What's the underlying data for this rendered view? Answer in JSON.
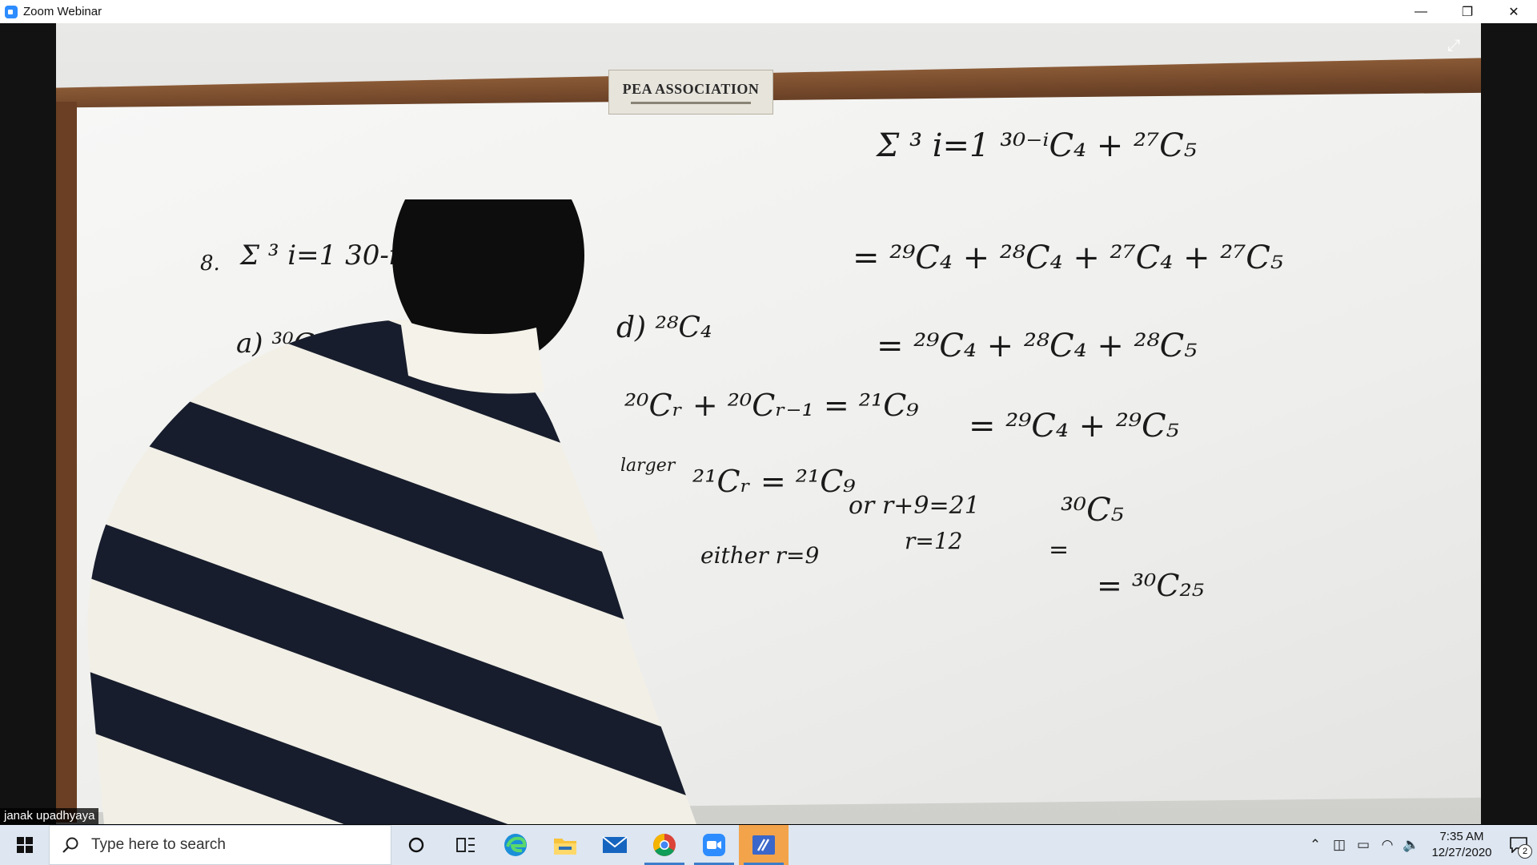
{
  "window": {
    "title": "Zoom Webinar",
    "controls": {
      "minimize": "—",
      "restore": "❐",
      "close": "✕"
    }
  },
  "video": {
    "participant_name": "janak upadhyaya",
    "plaque_title": "PEA ASSOCIATION",
    "board": {
      "left_sum_prefix": "8.",
      "left_sum": "Σ ³ i=1   30-i C₄ +",
      "option_a": "a)  ³⁰C₂₅",
      "option_d": "d)  ²⁸C₄",
      "comb_eq": "²⁰Cᵣ + ²⁰Cᵣ₋₁ = ²¹C₉",
      "larger": "larger",
      "comb_eq2": "²¹Cᵣ = ²¹C₉",
      "either": "either r=9",
      "or_line1": "or  r+9=21",
      "or_line2": "r=12",
      "rhs_sum": "Σ ³ i=1   ³⁰⁻ⁱC₄ + ²⁷C₅",
      "rhs_step1": "= ²⁹C₄ + ²⁸C₄ + ²⁷C₄ + ²⁷C₅",
      "rhs_step2": "= ²⁹C₄ + ²⁸C₄ + ²⁸C₅",
      "rhs_step3": "= ²⁹C₄ + ²⁹C₅",
      "rhs_step4": "³⁰C₅",
      "rhs_eq5": "=",
      "rhs_step5": "= ³⁰C₂₅"
    }
  },
  "taskbar": {
    "search_placeholder": "Type here to search",
    "time": "7:35 AM",
    "date": "12/27/2020",
    "notification_count": "2",
    "apps": [
      "task-view",
      "edge",
      "file-explorer",
      "mail",
      "chrome",
      "zoom",
      "whiteboard"
    ]
  },
  "colors": {
    "zoom_blue": "#2d8cff",
    "taskbar_bg": "#dde6f1",
    "active_app": "#f3a34a"
  }
}
